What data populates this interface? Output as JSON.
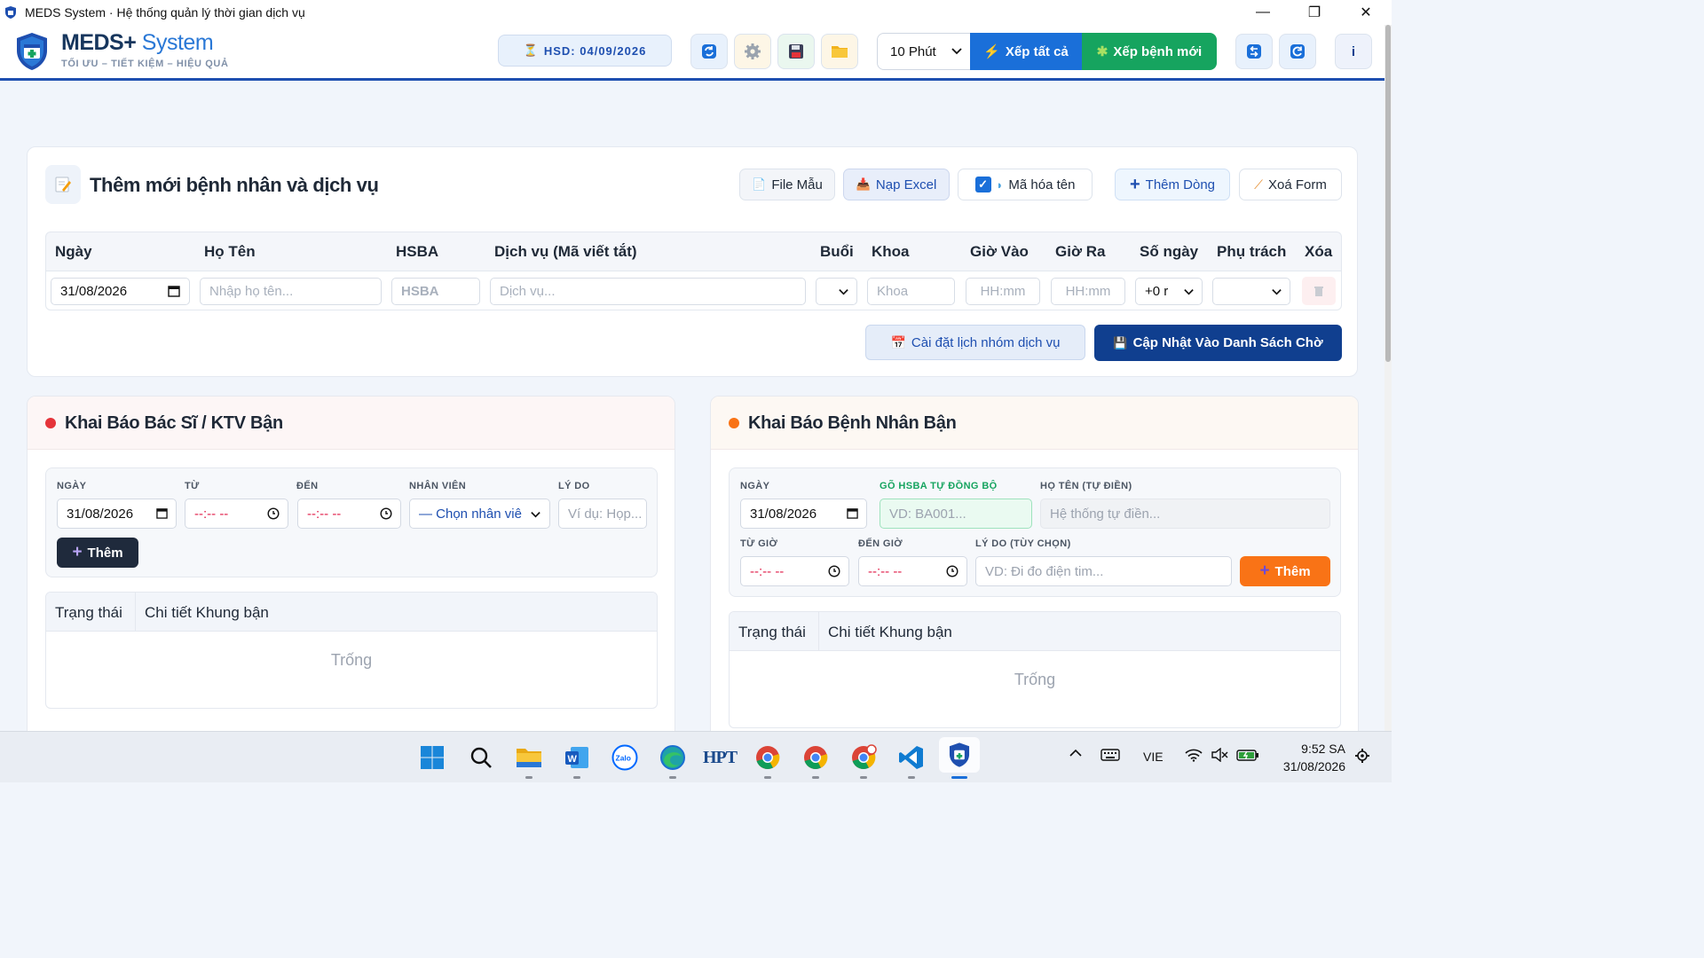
{
  "window": {
    "title": "MEDS System · Hệ thống quản lý thời gian dịch vụ"
  },
  "header": {
    "brand_main": "MEDS+",
    "brand_suffix": "System",
    "tagline": "TỐI ƯU – TIẾT KIỆM – HIỆU QUẢ",
    "hsd": "HSD: 04/09/2026",
    "interval": "10 Phút",
    "btn_xep_all": "Xếp tất cả",
    "btn_xep_moi": "Xếp bệnh mới",
    "info_label": "i"
  },
  "colors": {
    "primary": "#1e4fb0",
    "navy": "#103f8f",
    "green": "#16a45f",
    "blue": "#1a6fd9",
    "orange": "#f97316",
    "red_dot": "#e5343a"
  },
  "form": {
    "title": "Thêm mới bệnh nhân và dịch vụ",
    "btn_file_mau": "File Mẫu",
    "btn_nap_excel": "Nạp Excel",
    "chk_ma_hoa": "Mã hóa tên",
    "btn_them_dong": "Thêm Dòng",
    "btn_xoa_form": "Xoá Form",
    "columns": [
      "Ngày",
      "Họ Tên",
      "HSBA",
      "Dịch vụ (Mã viết tắt)",
      "Buổi",
      "Khoa",
      "Giờ Vào",
      "Giờ Ra",
      "Số ngày",
      "Phụ trách",
      "Xóa"
    ],
    "row": {
      "ngay": "31/08/2026",
      "ho_ten_ph": "Nhập họ tên...",
      "hsba_ph": "HSBA",
      "dich_vu_ph": "Dịch vụ...",
      "khoa_ph": "Khoa",
      "gio_vao_ph": "HH:mm",
      "gio_ra_ph": "HH:mm",
      "so_ngay": "+0 r"
    },
    "btn_cai_dat": "Cài đặt lịch nhóm dịch vụ",
    "btn_cap_nhat": "Cập Nhật Vào Danh Sách Chờ"
  },
  "doctor_panel": {
    "title": "Khai Báo Bác Sĩ / KTV Bận",
    "lbl_ngay": "NGÀY",
    "lbl_tu": "TỪ",
    "lbl_den": "ĐẾN",
    "lbl_nhan_vien": "NHÂN VIÊN",
    "lbl_ly_do": "LÝ DO",
    "ngay": "31/08/2026",
    "tu": "--:-- --",
    "den": "--:-- --",
    "nhan_vien": "— Chọn nhân viê",
    "ly_do_ph": "Ví dụ: Họp...",
    "btn_them": "Thêm",
    "col_status": "Trạng thái",
    "col_detail": "Chi tiết Khung bận",
    "empty": "Trống"
  },
  "patient_panel": {
    "title": "Khai Báo Bệnh Nhân Bận",
    "lbl_ngay": "NGÀY",
    "lbl_hsba": "GÕ HSBA TỰ ĐỒNG BỘ",
    "lbl_ho_ten": "HỌ TÊN (TỰ ĐIỀN)",
    "lbl_tu_gio": "TỪ GIỜ",
    "lbl_den_gio": "ĐẾN GIỜ",
    "lbl_ly_do": "LÝ DO (TÙY CHỌN)",
    "ngay": "31/08/2026",
    "hsba_ph": "VD: BA001...",
    "ho_ten_ph": "Hệ thống tự điền...",
    "tu_gio": "--:-- --",
    "den_gio": "--:-- --",
    "ly_do_ph": "VD: Đi đo điện tim...",
    "btn_them": "Thêm",
    "col_status": "Trạng thái",
    "col_detail": "Chi tiết Khung bận",
    "empty": "Trống"
  },
  "taskbar": {
    "hpt_label": "HPT",
    "zalo_label": "Zalo",
    "lang": "VIE",
    "time": "9:52 SA",
    "date": "31/08/2026"
  }
}
